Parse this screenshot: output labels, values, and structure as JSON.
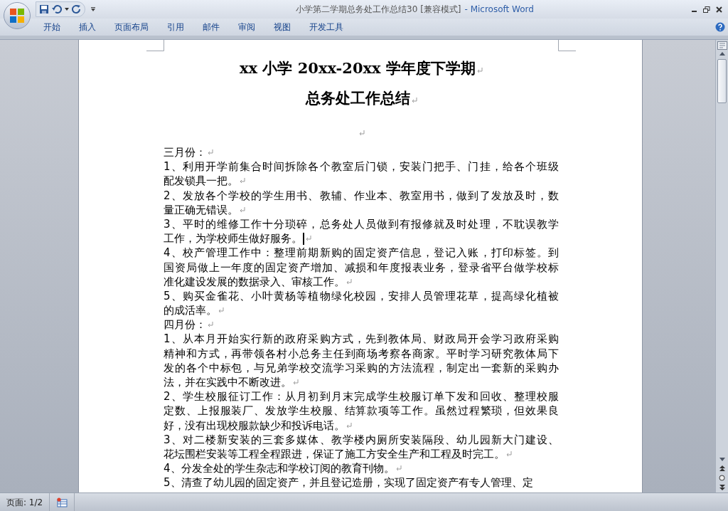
{
  "window": {
    "document_title": "小学第二学期总务处工作总结30 [兼容模式]",
    "app_name": "- Microsoft Word"
  },
  "ribbon_tabs": [
    {
      "label": "开始",
      "selected": false
    },
    {
      "label": "插入",
      "selected": false
    },
    {
      "label": "页面布局",
      "selected": false
    },
    {
      "label": "引用",
      "selected": false
    },
    {
      "label": "邮件",
      "selected": false
    },
    {
      "label": "审阅",
      "selected": false
    },
    {
      "label": "视图",
      "selected": false
    },
    {
      "label": "开发工具",
      "selected": false
    }
  ],
  "document": {
    "title_lines": [
      "xx 小学 20xx-20xx 学年度下学期",
      "总务处工作总结"
    ],
    "paragraphs": [
      {
        "lines": [
          "三月份："
        ],
        "cursor": false,
        "mark": true
      },
      {
        "lines": [
          "1、利用开学前集合时间拆除各个教室后门锁，安装门把手、门挂，给各个班级",
          "配发锁具一把。"
        ],
        "cursor": false,
        "mark": true
      },
      {
        "lines": [
          "2、发放各个学校的学生用书、教辅、作业本、教室用书，做到了发放及时，数",
          "量正确无错误。"
        ],
        "cursor": false,
        "mark": true
      },
      {
        "lines": [
          "3、平时的维修工作十分琐碎，总务处人员做到有报修就及时处理，不耽误教学",
          "工作，为学校师生做好服务。"
        ],
        "cursor": true,
        "mark": true
      },
      {
        "lines": [
          "4、校产管理工作中：整理前期新购的固定资产信息，登记入账，打印标签。到",
          "国资局做上一年度的固定资产增加、减损和年度报表业务，登录省平台做学校标",
          "准化建设发展的数据录入、审核工作。"
        ],
        "cursor": false,
        "mark": true
      },
      {
        "lines": [
          "5、购买金雀花、小叶黄杨等植物绿化校园，安排人员管理花草，提高绿化植被",
          "的成活率。"
        ],
        "cursor": false,
        "mark": true
      },
      {
        "lines": [
          "四月份："
        ],
        "cursor": false,
        "mark": true
      },
      {
        "lines": [
          "1、从本月开始实行新的政府采购方式，先到教体局、财政局开会学习政府采购",
          "精神和方式，再带领各村小总务主任到商场考察各商家。平时学习研究教体局下",
          "发的各个中标包，与兄弟学校交流学习采购的方法流程，制定出一套新的采购办",
          "法，并在实践中不断改进。"
        ],
        "cursor": false,
        "mark": true
      },
      {
        "lines": [
          "2、学生校服征订工作：从月初到月末完成学生校服订单下发和回收、整理校服",
          "定数、上报服装厂、发放学生校服、结算款项等工作。虽然过程繁琐，但效果良",
          "好，没有出现校服款缺少和投诉电话。"
        ],
        "cursor": false,
        "mark": true
      },
      {
        "lines": [
          "3、对二楼新安装的三套多媒体、教学楼内厕所安装隔段、幼儿园新大门建设、",
          "花坛围栏安装等工程全程跟进，保证了施工方安全生产和工程及时完工。"
        ],
        "cursor": false,
        "mark": true
      },
      {
        "lines": [
          "4、分发全处的学生杂志和学校订阅的教育刊物。"
        ],
        "cursor": false,
        "mark": true
      },
      {
        "lines": [
          "5、清查了幼儿园的固定资产，并且登记造册，实现了固定资产有专人管理、定"
        ],
        "cursor": false,
        "mark": false
      }
    ]
  },
  "status_bar": {
    "page": "页面: 1/2"
  }
}
